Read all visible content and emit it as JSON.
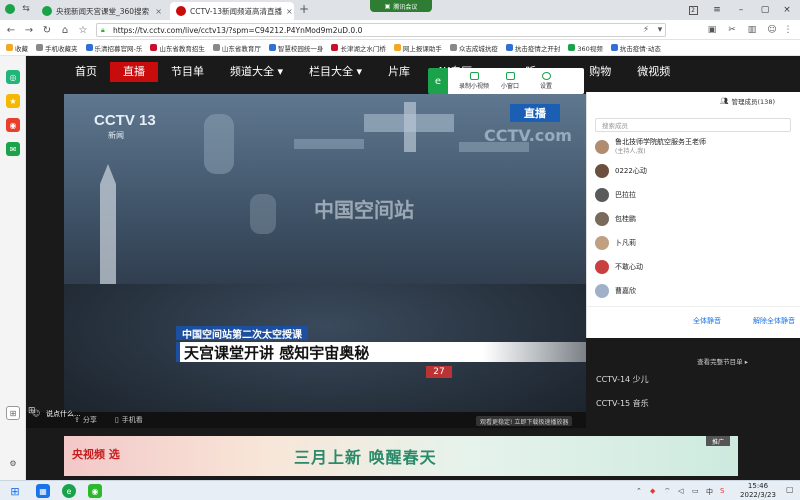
{
  "tabs": [
    {
      "label": "央视新闻天宫课堂_360搜索",
      "color": "#1aa34a"
    },
    {
      "label": "CCTV-13新闻频道高清直播",
      "color": "#c80c0c"
    }
  ],
  "meeting_label": "腾讯会议",
  "address": {
    "url": "https://tv.cctv.com/live/cctv13/?spm=C94212.P4YnMod9m2uD.0.0"
  },
  "bookmarks": [
    {
      "label": "收藏",
      "color": "#f5a623"
    },
    {
      "label": "手机收藏夹",
      "color": "#888"
    },
    {
      "label": "乐清招募官网-乐",
      "color": "#2f6fd6"
    },
    {
      "label": "山东省教育招生",
      "color": "#c8102e"
    },
    {
      "label": "山东省教育厅",
      "color": "#888"
    },
    {
      "label": "智慧校园统一身",
      "color": "#2f6fd6"
    },
    {
      "label": "长津湖之水门桥",
      "color": "#c8102e"
    },
    {
      "label": "网上报课助手",
      "color": "#f5a623"
    },
    {
      "label": "众志成城抗疫",
      "color": "#888"
    },
    {
      "label": "抗击疫情之开封",
      "color": "#2f6fd6"
    },
    {
      "label": "360视频",
      "color": "#1aa34a"
    },
    {
      "label": "抗击疫情·动态",
      "color": "#2f6fd6"
    }
  ],
  "nav": [
    "首页",
    "直播",
    "节目单",
    "频道大全 ▾",
    "栏目大全 ▾",
    "片库",
    "4K专区",
    "听",
    "",
    "购物",
    "微视频"
  ],
  "player": {
    "logo": "CCTV 13",
    "logo_sub": "新闻",
    "live_badge": "直播",
    "watermark": "CCTV.com",
    "center_title": "中国空间站",
    "caption_top": "中国空间站第二次太空授课",
    "caption_main": "天宫课堂开讲  感知宇宙奥秘",
    "channel_num": "27",
    "toolbar": [
      {
        "label": "录制小视频"
      },
      {
        "label": "小窗口"
      },
      {
        "label": "设置"
      }
    ],
    "share_label": "分享",
    "mobile_label": "手机看",
    "tip": "观看更稳定! 立即下载极速播放器"
  },
  "chat": {
    "members_label": "管理成员(138)",
    "search_placeholder": "搜索成员",
    "members": [
      {
        "name": "鲁北技师学院航空服务王老师",
        "sub": "(主持人,我)"
      },
      {
        "name": "0222心动",
        "sub": ""
      },
      {
        "name": "巴拉拉",
        "sub": ""
      },
      {
        "name": "包桂鹏",
        "sub": ""
      },
      {
        "name": "卜凡莉",
        "sub": ""
      },
      {
        "name": "不敢心动",
        "sub": ""
      },
      {
        "name": "曹嘉欣",
        "sub": ""
      }
    ],
    "mute_all": "全体静音",
    "unmute_all": "解除全体静音",
    "say": "说点什么..."
  },
  "channels": {
    "see_all": "查看完整节目单 ▸",
    "items": [
      "CCTV-14 少儿",
      "CCTV-15 音乐"
    ]
  },
  "banner": {
    "logo": "央视频 选",
    "text": "三月上新  唤醒春天",
    "ad": "推广"
  },
  "taskbar": {
    "time": "15:46",
    "date": "2022/3/23",
    "ime": "中"
  }
}
